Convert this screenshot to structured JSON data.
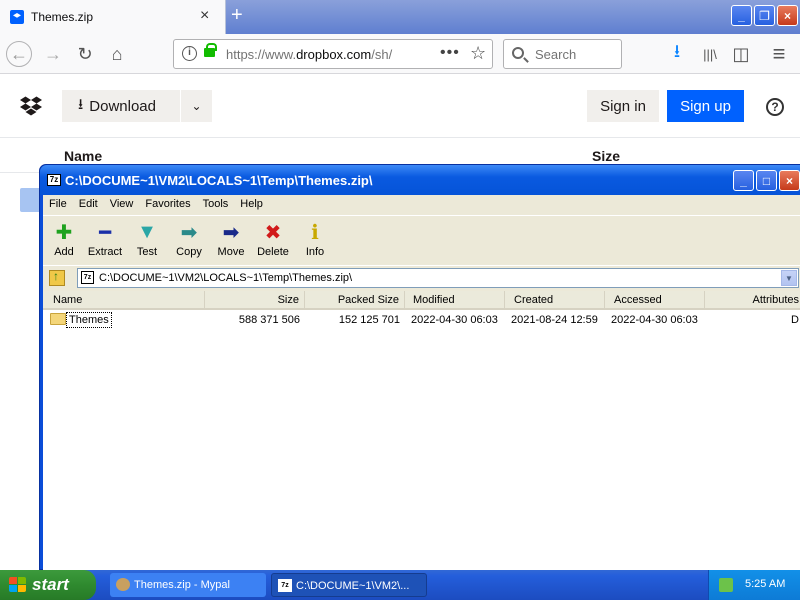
{
  "browser": {
    "tab_title": "Themes.zip",
    "tab_close_glyph": "×",
    "new_tab_glyph": "+",
    "url_prefix": "https://www.",
    "url_domain": "dropbox.com",
    "url_path": "/sh/",
    "url_more_glyph": "•••",
    "search_placeholder": "Search",
    "icons": {
      "back": "arrow-left-icon",
      "forward": "arrow-right-icon",
      "reload": "reload-icon",
      "home": "home-icon",
      "downloads": "download-arrow-icon",
      "library": "library-icon",
      "sidebar": "sidebar-icon",
      "menu": "hamburger-menu-icon"
    },
    "glyphs": {
      "back": "←",
      "forward": "→",
      "reload": "↻",
      "home": "⌂",
      "downloads": "⭳",
      "library": "|||\\",
      "sidebar": "◫",
      "menu": "≡",
      "star": "☆",
      "info": "i"
    },
    "window_buttons": {
      "minimize": "_",
      "restore": "❐",
      "close": "×"
    }
  },
  "dropbox": {
    "download_label": "Download",
    "download_glyph": "⭳",
    "caret_glyph": "⌄",
    "signin_label": "Sign in",
    "signup_label": "Sign up",
    "help_glyph": "?",
    "columns": {
      "name": "Name",
      "size": "Size"
    },
    "accent_color": "#0061fe"
  },
  "zip": {
    "title": "C:\\DOCUME~1\\VM2\\LOCALS~1\\Temp\\Themes.zip\\",
    "icon_text": "7z",
    "menu": [
      "File",
      "Edit",
      "View",
      "Favorites",
      "Tools",
      "Help"
    ],
    "toolbar": [
      {
        "label": "Add",
        "glyph": "✚",
        "color": "#1fa21f"
      },
      {
        "label": "Extract",
        "glyph": "━",
        "color": "#1a2fa8"
      },
      {
        "label": "Test",
        "glyph": "▼",
        "color": "#2aa6a6"
      },
      {
        "label": "Copy",
        "glyph": "➡",
        "color": "#2a8a8a"
      },
      {
        "label": "Move",
        "glyph": "➡",
        "color": "#1a2a8a"
      },
      {
        "label": "Delete",
        "glyph": "✖",
        "color": "#d11a1a"
      },
      {
        "label": "Info",
        "glyph": "ℹ",
        "color": "#c8a800"
      }
    ],
    "address": "C:\\DOCUME~1\\VM2\\LOCALS~1\\Temp\\Themes.zip\\",
    "dropdown_glyph": "▼",
    "columns": [
      "Name",
      "Size",
      "Packed Size",
      "Modified",
      "Created",
      "Accessed",
      "Attributes"
    ],
    "rows": [
      {
        "name": "Themes",
        "size": "588 371 506",
        "packed_size": "152 125 701",
        "modified": "2022-04-30 06:03",
        "created": "2021-08-24 12:59",
        "accessed": "2022-04-30 06:03",
        "attributes": "D"
      }
    ]
  },
  "taskbar": {
    "start_label": "start",
    "tasks": [
      "Themes.zip - Mypal",
      "C:\\DOCUME~1\\VM2\\..."
    ],
    "task_icon_text": "7z",
    "clock": "5:25 AM"
  }
}
